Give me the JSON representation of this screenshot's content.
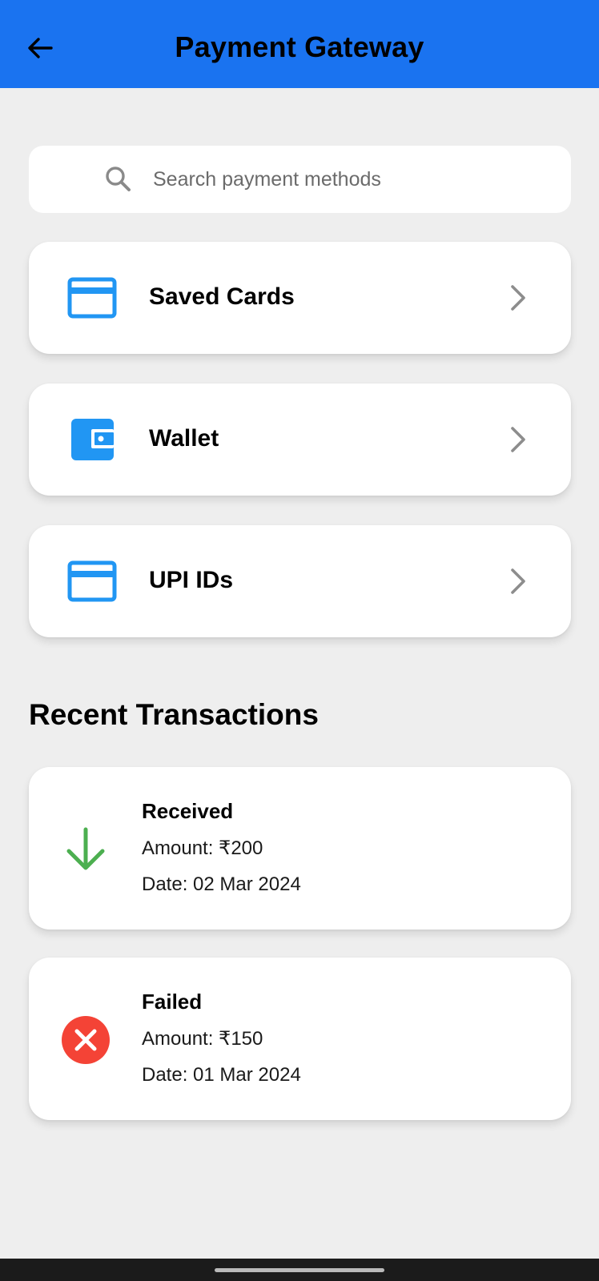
{
  "appbar": {
    "title": "Payment Gateway",
    "back_icon": "arrow-left-icon"
  },
  "search": {
    "placeholder": "Search payment methods",
    "value": ""
  },
  "methods": [
    {
      "label": "Saved Cards",
      "icon": "credit-card-icon"
    },
    {
      "label": "Wallet",
      "icon": "wallet-icon"
    },
    {
      "label": "UPI IDs",
      "icon": "credit-card-icon"
    }
  ],
  "transactions": {
    "title": "Recent Transactions",
    "items": [
      {
        "status": "Received",
        "amount": "Amount: ₹200",
        "date": "Date: 02 Mar 2024",
        "icon": "arrow-down-icon",
        "color": "#4caf50"
      },
      {
        "status": "Failed",
        "amount": "Amount: ₹150",
        "date": "Date: 01 Mar 2024",
        "icon": "error-icon",
        "color": "#f44336"
      }
    ]
  },
  "colors": {
    "primary": "#1a73f0",
    "icon_blue": "#2196f3",
    "background": "#eeeeee"
  }
}
